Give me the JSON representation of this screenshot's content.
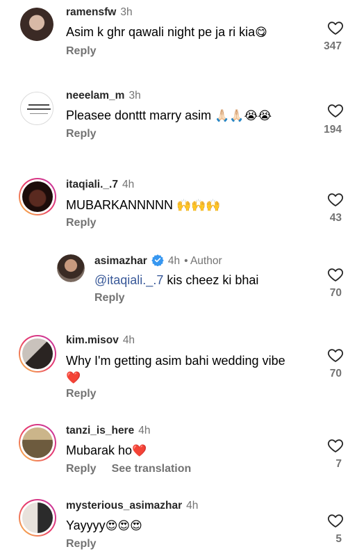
{
  "comments": [
    {
      "username": "ramensfw",
      "time": "3h",
      "text": "Asim k ghr qawali night pe ja ri kia",
      "emoji": "😋",
      "reply": "Reply",
      "likes": "347"
    },
    {
      "username": "neeelam_m",
      "time": "3h",
      "text": "Pleasee donttt marry asim",
      "emoji": "🙏🏻🙏🏻😭😭",
      "reply": "Reply",
      "likes": "194"
    },
    {
      "username": "itaqiali._.7",
      "time": "4h",
      "text": "MUBARKANNNNN ",
      "emoji": "🙌🙌🙌",
      "reply": "Reply",
      "likes": "43"
    },
    {
      "username": "asimazhar",
      "time": "4h",
      "author": "• Author",
      "mention": "@itaqiali._.7",
      "text": " kis cheez ki bhai",
      "reply": "Reply",
      "likes": "70"
    },
    {
      "username": "kim.misov",
      "time": "4h",
      "text": "Why I'm getting asim bahi wedding vibe",
      "emoji": "❤️",
      "reply": "Reply",
      "likes": "70"
    },
    {
      "username": "tanzi_is_here",
      "time": "4h",
      "text": "Mubarak ho",
      "emoji": "❤️",
      "reply": "Reply",
      "translate": "See translation",
      "likes": "7"
    },
    {
      "username": "mysterious_asimazhar",
      "time": "4h",
      "text": "Yayyyy",
      "emoji": "😍😍😍",
      "reply": "Reply",
      "likes": "5"
    }
  ],
  "icons": {
    "like": "heart-outline-icon",
    "verified": "verified-badge-icon"
  },
  "colors": {
    "verified": "#3797f0",
    "muted": "#737373",
    "mention": "#385898"
  }
}
